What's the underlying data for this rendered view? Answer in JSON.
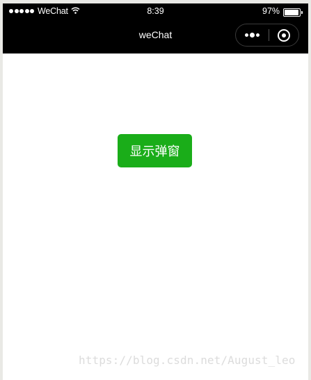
{
  "status_bar": {
    "carrier": "WeChat",
    "time": "8:39",
    "battery_percent": "97%",
    "battery_level": 0.97,
    "signal_icon": "signal-dots-icon",
    "wifi_icon": "wifi-icon"
  },
  "nav_bar": {
    "title": "weChat",
    "more_icon": "more-dots-icon",
    "close_icon": "target-circle-icon"
  },
  "main": {
    "show_button_label": "显示弹窗"
  },
  "watermark": {
    "text": "https://blog.csdn.net/August_leo"
  },
  "colors": {
    "nav_background": "#000000",
    "button_green": "#1aad19",
    "page_background": "#ffffff"
  }
}
